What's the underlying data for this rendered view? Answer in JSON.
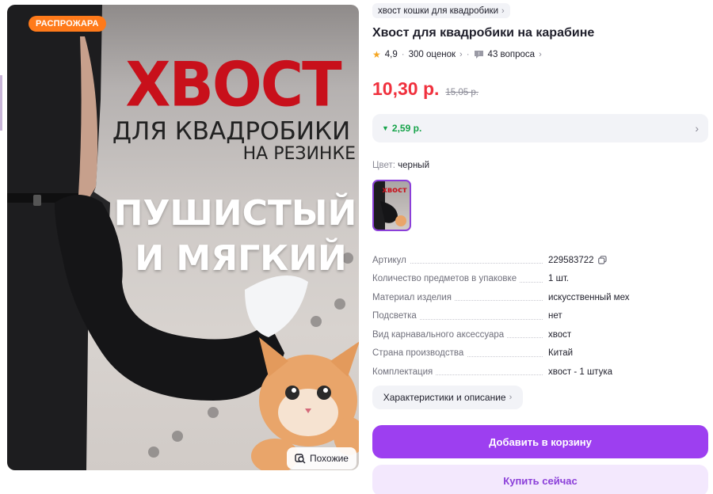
{
  "image": {
    "badge": "РАСПРОЖАРА",
    "text_line1": "ХВОСТ",
    "text_line2": "ДЛЯ КВАДРОБИКИ",
    "text_line3": "НА РЕЗИНКЕ",
    "text_line4": "ПУШИСТЫЙ",
    "text_line5": "И МЯГКИЙ",
    "similar_label": "Похожие"
  },
  "breadcrumb": "хвост кошки для квадробики",
  "product": {
    "title": "Хвост для квадробики на карабине",
    "rating": "4,9",
    "reviews": "300 оценок",
    "questions": "43 вопроса",
    "price": "10,30 р.",
    "old_price": "15,05 р.",
    "discount": "2,59 р.",
    "color_label": "Цвет:",
    "color_value": "черный",
    "thumb_text": "хвост"
  },
  "specs": [
    {
      "name": "Артикул",
      "value": "229583722"
    },
    {
      "name": "Количество предметов в упаковке",
      "value": "1 шт."
    },
    {
      "name": "Материал изделия",
      "value": "искусственный мех"
    },
    {
      "name": "Подсветка",
      "value": "нет"
    },
    {
      "name": "Вид карнавального аксессуара",
      "value": "хвост"
    },
    {
      "name": "Страна производства",
      "value": "Китай"
    },
    {
      "name": "Комплектация",
      "value": "хвост - 1 штука"
    }
  ],
  "buttons": {
    "characteristics": "Характеристики и описание",
    "add_to_cart": "Добавить в корзину",
    "buy_now": "Купить сейчас"
  },
  "colors": {
    "accent": "#9d3ff0",
    "price_red": "#f0303d",
    "discount_green": "#16a34a",
    "sale_orange": "#ff7a1a"
  }
}
